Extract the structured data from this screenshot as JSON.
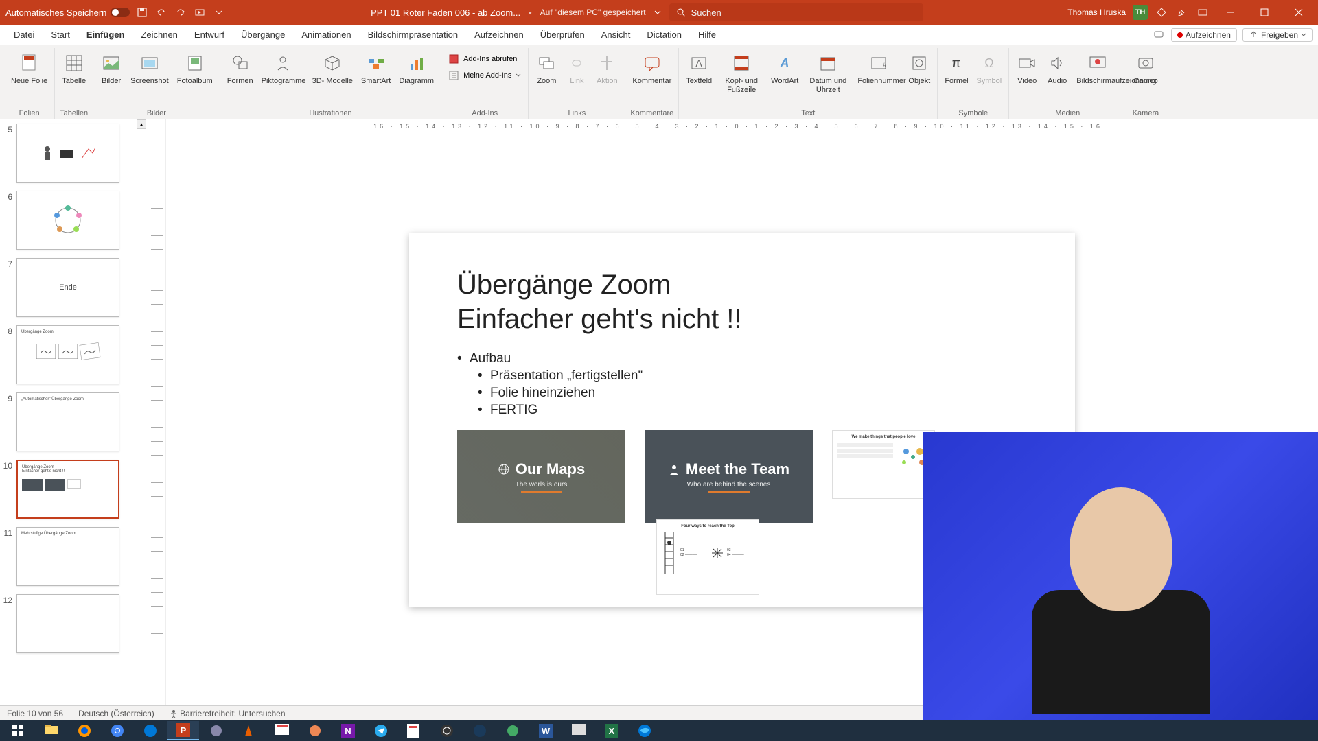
{
  "titlebar": {
    "autosave": "Automatisches Speichern",
    "doc": "PPT 01 Roter Faden 006 - ab Zoom...",
    "saved": "Auf \"diesem PC\" gespeichert",
    "search_placeholder": "Suchen",
    "user_name": "Thomas Hruska",
    "user_initials": "TH"
  },
  "tabs": {
    "items": [
      "Datei",
      "Start",
      "Einfügen",
      "Zeichnen",
      "Entwurf",
      "Übergänge",
      "Animationen",
      "Bildschirmpräsentation",
      "Aufzeichnen",
      "Überprüfen",
      "Ansicht",
      "Dictation",
      "Hilfe"
    ],
    "active": "Einfügen",
    "record": "Aufzeichnen",
    "share": "Freigeben"
  },
  "ribbon": {
    "groups": {
      "folien": {
        "label": "Folien",
        "neue_folie": "Neue\nFolie"
      },
      "tabellen": {
        "label": "Tabellen",
        "tabelle": "Tabelle"
      },
      "bilder": {
        "label": "Bilder",
        "bilder": "Bilder",
        "screenshot": "Screenshot",
        "fotoalbum": "Fotoalbum"
      },
      "illustrationen": {
        "label": "Illustrationen",
        "formen": "Formen",
        "piktogramme": "Piktogramme",
        "dmodelle": "3D-\nModelle",
        "smartart": "SmartArt",
        "diagramm": "Diagramm"
      },
      "addins": {
        "label": "Add-Ins",
        "abrufen": "Add-Ins abrufen",
        "meine": "Meine Add-Ins"
      },
      "links": {
        "label": "Links",
        "zoom": "Zoom",
        "link": "Link",
        "aktion": "Aktion"
      },
      "kommentare": {
        "label": "Kommentare",
        "kommentar": "Kommentar"
      },
      "text": {
        "label": "Text",
        "textfeld": "Textfeld",
        "kopf": "Kopf- und\nFußzeile",
        "wordart": "WordArt",
        "datum": "Datum und\nUhrzeit",
        "foliennummer": "Foliennummer",
        "objekt": "Objekt"
      },
      "symbole": {
        "label": "Symbole",
        "formel": "Formel",
        "symbol": "Symbol"
      },
      "medien": {
        "label": "Medien",
        "video": "Video",
        "audio": "Audio",
        "bildschirm": "Bildschirmaufzeichnung"
      },
      "kamera": {
        "label": "Kamera",
        "cameo": "Cameo"
      }
    }
  },
  "ruler": "16 · 15 · 14 · 13 · 12 · 11 · 10 · 9 · 8 · 7 · 6 · 5 · 4 · 3 · 2 · 1 · 0 · 1 · 2 · 3 · 4 · 5 · 6 · 7 · 8 · 9 · 10 · 11 · 12 · 13 · 14 · 15 · 16",
  "thumbs": [
    {
      "num": "5"
    },
    {
      "num": "6"
    },
    {
      "num": "7",
      "text": "Ende"
    },
    {
      "num": "8",
      "text": "Übergänge Zoom"
    },
    {
      "num": "9",
      "text": "„Automatischer\" Übergänge Zoom"
    },
    {
      "num": "10",
      "text": "Übergänge Zoom\nEinfacher geht's nicht !!",
      "selected": true
    },
    {
      "num": "11",
      "text": "Mehrstufige Übergänge Zoom"
    },
    {
      "num": "12"
    }
  ],
  "slide": {
    "title_l1": "Übergänge Zoom",
    "title_l2": "Einfacher geht's nicht !!",
    "b1": "Aufbau",
    "b2": "Präsentation „fertigstellen\"",
    "b3": "Folie hineinziehen",
    "b4": "FERTIG",
    "card1_title": "Our Maps",
    "card1_sub": "The worls is ours",
    "card2_title": "Meet the Team",
    "card2_sub": "Who are behind the scenes",
    "mini1_title": "We make things that people love",
    "mini2_title": "Four ways to reach the Top"
  },
  "status": {
    "slide": "Folie 10 von 56",
    "lang": "Deutsch (Österreich)",
    "access": "Barrierefreiheit: Untersuchen"
  }
}
